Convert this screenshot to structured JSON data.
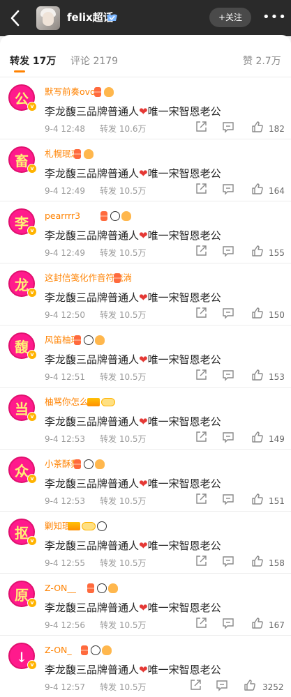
{
  "header": {
    "title": "felix超话",
    "follow_label": "+关注",
    "more_label": "•••"
  },
  "tabs": {
    "repost_label": "转发 17万",
    "comment_label": "评论 2179",
    "like_label": "赞 2.7万"
  },
  "colors": {
    "accent": "#ff8200",
    "username": "#ff8200",
    "avatar_bg": "#ff1a8c"
  },
  "repost_prefix": "转发",
  "items": [
    {
      "avatar_char": "公",
      "username": "默写前奏ovo",
      "badges": [
        "hourglass",
        "bread"
      ],
      "text_before": "李龙馥三品牌普通人",
      "text_after": "唯一宋智恩老公",
      "time": "9-4 12:48",
      "reposts": "转发 10.6万",
      "likes": "182"
    },
    {
      "avatar_char": "畜",
      "username": "札幌珉恋",
      "badges": [
        "hourglass",
        "bread"
      ],
      "text_before": "李龙馥三品牌普通人",
      "text_after": "唯一宋智恩老公",
      "time": "9-4 12:49",
      "reposts": "转发 10.5万",
      "likes": "164"
    },
    {
      "avatar_char": "李",
      "username": "pearrrr3",
      "badges": [
        "hourglass",
        "panda",
        "bread"
      ],
      "text_before": "李龙馥三品牌普通人",
      "text_after": "唯一宋智恩老公",
      "time": "9-4 12:49",
      "reposts": "转发 10.5万",
      "likes": "155"
    },
    {
      "avatar_char": "龙",
      "username": "这封信笺化作音符流淌",
      "badges": [
        "hourglass"
      ],
      "text_before": "李龙馥三品牌普通人",
      "text_after": "唯一宋智恩老公",
      "time": "9-4 12:50",
      "reposts": "转发 10.5万",
      "likes": "150"
    },
    {
      "avatar_char": "馥",
      "username": "风笛柚珉",
      "badges": [
        "hourglass",
        "panda",
        "bread"
      ],
      "text_before": "李龙馥三品牌普通人",
      "text_after": "唯一宋智恩老公",
      "time": "9-4 12:51",
      "reposts": "转发 10.5万",
      "likes": "153"
    },
    {
      "avatar_char": "当",
      "username": "柚骂你怎么了",
      "badges": [
        "crown",
        "level"
      ],
      "text_before": "李龙馥三品牌普通人",
      "text_after": "唯一宋智恩老公",
      "time": "9-4 12:53",
      "reposts": "转发 10.5万",
      "likes": "149"
    },
    {
      "avatar_char": "众",
      "username": "小茶酥梨",
      "badges": [
        "hourglass",
        "panda",
        "bread"
      ],
      "text_before": "李龙馥三品牌普通人",
      "text_after": "唯一宋智恩老公",
      "time": "9-4 12:53",
      "reposts": "转发 10.5万",
      "likes": "151"
    },
    {
      "avatar_char": "抠",
      "username": "剿知珉",
      "badges": [
        "crown",
        "level",
        "panda"
      ],
      "text_before": "李龙馥三品牌普通人",
      "text_after": "唯一宋智恩老公",
      "time": "9-4 12:55",
      "reposts": "转发 10.5万",
      "likes": "158"
    },
    {
      "avatar_char": "原",
      "username": "Z-ON__",
      "badges": [
        "hourglass",
        "panda",
        "bread"
      ],
      "text_before": "李龙馥三品牌普通人",
      "text_after": "唯一宋智恩老公",
      "time": "9-4 12:56",
      "reposts": "转发 10.5万",
      "likes": "167"
    },
    {
      "avatar_char": "↓",
      "username": "Z-ON_",
      "badges": [
        "hourglass",
        "panda",
        "bread"
      ],
      "text_before": "李龙馥三品牌普通人",
      "text_after": "唯一宋智恩老公",
      "time": "9-4 12:57",
      "reposts": "转发 10.5万",
      "likes": "3252"
    }
  ],
  "icons": {
    "back": "chevron-left-icon",
    "verified": "verified-icon",
    "share": "share-icon",
    "reply": "comment-icon",
    "like": "thumbs-up-icon",
    "heart": "heart-icon"
  }
}
